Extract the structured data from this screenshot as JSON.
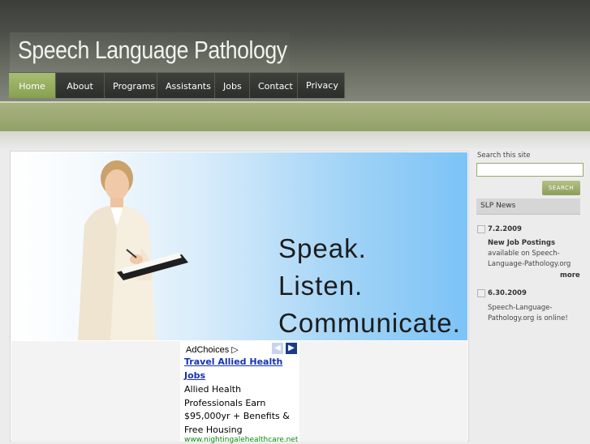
{
  "site": {
    "title": "Speech Language Pathology"
  },
  "nav": {
    "items": [
      {
        "label": "Home",
        "active": true
      },
      {
        "label": "About"
      },
      {
        "label": "Programs"
      },
      {
        "label": "Assistants"
      },
      {
        "label": "Jobs"
      },
      {
        "label": "Contact"
      },
      {
        "label": "Privacy"
      }
    ]
  },
  "hero": {
    "taglines": [
      "Speak.",
      "Listen.",
      "Communicate."
    ]
  },
  "ad": {
    "choices_label": "AdChoices",
    "choices_icon": "adchoices-triangle-icon",
    "prev_icon": "chevron-left-icon",
    "next_icon": "chevron-right-icon",
    "title": "Travel Allied Health Jobs",
    "body": "Allied Health Professionals Earn $95,000yr + Benefits & Free Housing",
    "url": "www.nightingalehealthcare.net"
  },
  "sidebar": {
    "search_label": "Search this site",
    "search_value": "",
    "search_button": "SEARCH",
    "news_header": "SLP News",
    "news": [
      {
        "date": "7.2.2009",
        "headline": "New Job Postings",
        "text": "available on Speech-Language-Pathology.org",
        "more": "more"
      },
      {
        "date": "6.30.2009",
        "headline": "",
        "text": "Speech-Language-Pathology.org is online!"
      }
    ]
  },
  "colors": {
    "accent_green": "#9aab66",
    "header_dark": "#3e413b",
    "link_blue": "#1533b9",
    "ad_url_green": "#0a8a0a"
  }
}
